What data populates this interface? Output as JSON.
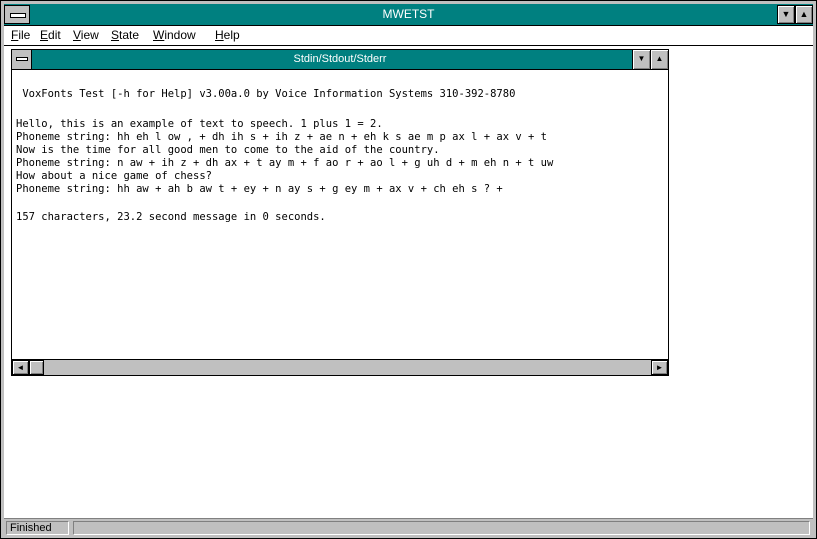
{
  "window": {
    "title": "MWETST",
    "minimize_glyph": "▼",
    "maximize_glyph": "▲"
  },
  "menu": [
    {
      "key": "F",
      "rest": "ile"
    },
    {
      "key": "E",
      "rest": "dit"
    },
    {
      "key": "V",
      "rest": "iew"
    },
    {
      "key": "S",
      "rest": "tate"
    },
    {
      "key": "W",
      "rest": "indow"
    },
    {
      "key": "H",
      "rest": "elp"
    }
  ],
  "child": {
    "title": "Stdin/Stdout/Stderr",
    "minimize_glyph": "▼",
    "maximize_glyph": "▲",
    "lines": [
      " VoxFonts Test [-h for Help] v3.00a.0 by Voice Information Systems 310-392-8780",
      "",
      "Hello, this is an example of text to speech. 1 plus 1 = 2.",
      "Phoneme string: hh eh l ow , + dh ih s + ih z + ae n + eh k s ae m p ax l + ax v + t",
      "Now is the time for all good men to come to the aid of the country.",
      "Phoneme string: n aw + ih z + dh ax + t ay m + f ao r + ao l + g uh d + m eh n + t uw",
      "How about a nice game of chess?",
      "Phoneme string: hh aw + ah b aw t + ey + n ay s + g ey m + ax v + ch eh s ? +",
      "",
      "157 characters, 23.2 second message in 0 seconds."
    ],
    "scroll_left_glyph": "◄",
    "scroll_right_glyph": "►"
  },
  "status": {
    "text": "Finished"
  },
  "colors": {
    "titlebar": "#008080",
    "desktop": "#c4c8fe",
    "face": "#c0c0c0"
  }
}
